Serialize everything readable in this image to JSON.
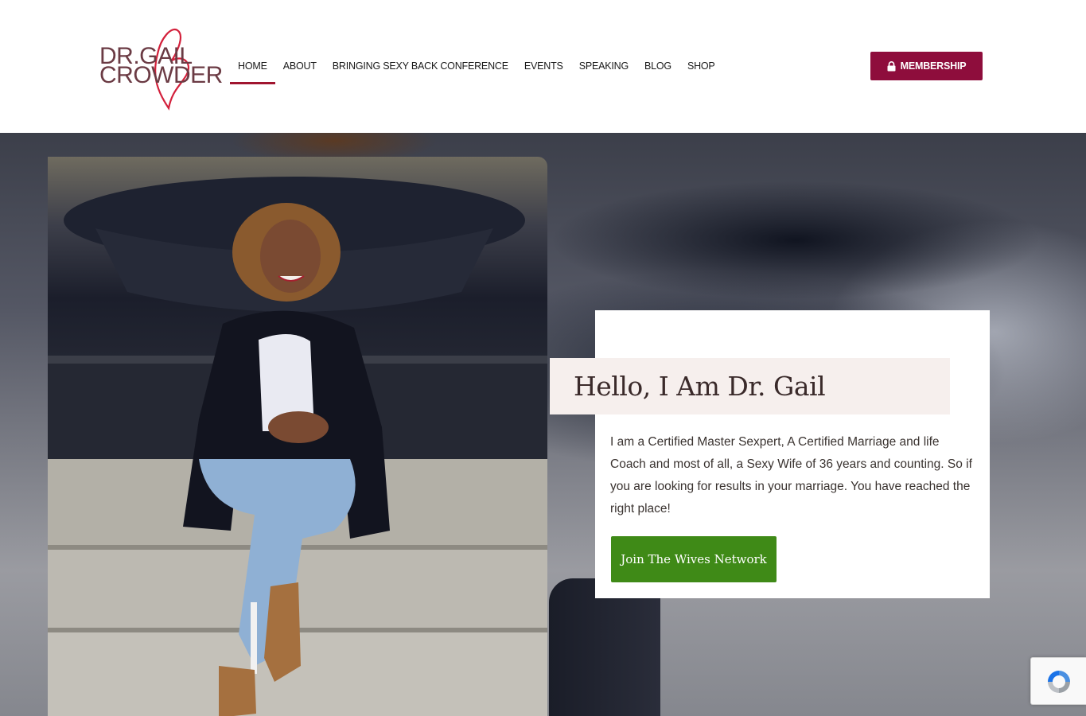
{
  "brand": {
    "logo_line1": "DR.GAIL",
    "logo_line2": "CROWDER",
    "heart_color": "#d3203b"
  },
  "nav": {
    "items": [
      {
        "label": "HOME",
        "active": true
      },
      {
        "label": "ABOUT",
        "active": false
      },
      {
        "label": "BRINGING SEXY BACK CONFERENCE",
        "active": false
      },
      {
        "label": "EVENTS",
        "active": false
      },
      {
        "label": "SPEAKING",
        "active": false
      },
      {
        "label": "BLOG",
        "active": false
      },
      {
        "label": "SHOP",
        "active": false
      }
    ],
    "membership_label": "MEMBERSHIP"
  },
  "hero": {
    "heading": "Hello, I Am Dr. Gail",
    "body": "I am a Certified Master Sexpert, A Certified Marriage and life Coach and most of all, a Sexy Wife of 36 years and counting. So if you are looking for results in your marriage. You have reached the right place!",
    "cta_label": "Join The Wives Network"
  },
  "icons": {
    "lock": "lock-icon",
    "recaptcha": "recaptcha-icon"
  },
  "colors": {
    "accent": "#8e0d3c",
    "nav_underline": "#a0152f",
    "cta": "#3f8a17",
    "title_band": "#f6efed"
  }
}
